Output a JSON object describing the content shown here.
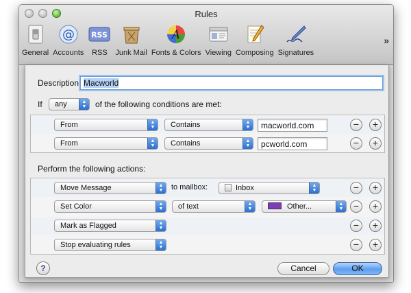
{
  "window": {
    "title": "Rules"
  },
  "toolbar": {
    "items": [
      {
        "label": "General",
        "icon": "light-switch-icon"
      },
      {
        "label": "Accounts",
        "icon": "at-sign-icon"
      },
      {
        "label": "RSS",
        "icon": "rss-icon"
      },
      {
        "label": "Junk Mail",
        "icon": "junk-mail-bin-icon"
      },
      {
        "label": "Fonts & Colors",
        "icon": "fonts-colors-icon"
      },
      {
        "label": "Viewing",
        "icon": "viewing-icon"
      },
      {
        "label": "Composing",
        "icon": "composing-pencil-icon"
      },
      {
        "label": "Signatures",
        "icon": "signature-pen-icon"
      }
    ],
    "overflow": "»"
  },
  "sheet": {
    "description_label": "Description:",
    "description_value": "Macworld",
    "if_label": "If",
    "match_mode": "any",
    "conditions_suffix": "of the following conditions are met:",
    "conditions": [
      {
        "field": "From",
        "operator": "Contains",
        "value": "macworld.com"
      },
      {
        "field": "From",
        "operator": "Contains",
        "value": "pcworld.com"
      }
    ],
    "actions_heading": "Perform the following actions:",
    "actions": {
      "move": {
        "action": "Move Message",
        "connector": "to mailbox:",
        "mailbox": "Inbox"
      },
      "color": {
        "action": "Set Color",
        "target": "of text",
        "color_label": "Other...",
        "swatch_color": "#7a3fb0"
      },
      "flag": {
        "action": "Mark as Flagged"
      },
      "stop": {
        "action": "Stop evaluating rules"
      }
    },
    "remove_symbol": "−",
    "add_symbol": "+",
    "help_symbol": "?",
    "cancel_label": "Cancel",
    "ok_label": "OK"
  }
}
